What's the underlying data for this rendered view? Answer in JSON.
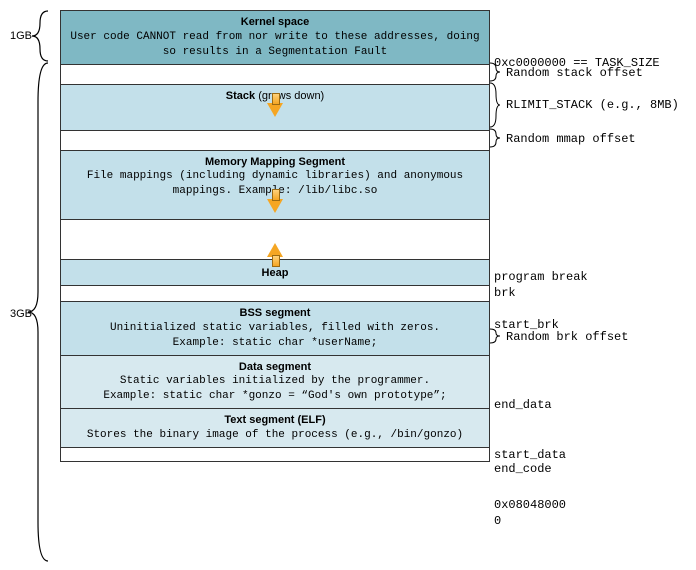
{
  "left": {
    "top_size": "1GB",
    "bottom_size": "3GB"
  },
  "kernel": {
    "title": "Kernel space",
    "desc": "User code CANNOT read from nor write to these addresses, doing so results in a Segmentation Fault"
  },
  "stack": {
    "title": "Stack",
    "suffix": " (grows down)"
  },
  "mmap": {
    "title": "Memory Mapping Segment",
    "desc": "File mappings (including dynamic libraries) and anonymous mappings. Example: /lib/libc.so"
  },
  "heap": {
    "title": "Heap"
  },
  "bss": {
    "title": "BSS segment",
    "desc1": "Uninitialized static variables, filled with zeros.",
    "desc2": "Example: static char *userName;"
  },
  "dataseg": {
    "title": "Data segment",
    "desc1": "Static variables initialized by the programmer.",
    "desc2": "Example: static char *gonzo = “God's own prototype”;"
  },
  "textseg": {
    "title": "Text segment (ELF)",
    "desc": "Stores the binary image of the process (e.g., /bin/gonzo)"
  },
  "right": {
    "task_size": "0xc0000000 == TASK_SIZE",
    "rand_stack": "Random stack offset",
    "rlimit": "RLIMIT_STACK (e.g., 8MB)",
    "rand_mmap": "Random mmap offset",
    "prog_break": "program break",
    "brk": "brk",
    "start_brk": "start_brk",
    "rand_brk": "Random brk offset",
    "end_data": "end_data",
    "start_data": "start_data",
    "end_code": "end_code",
    "text_addr": "0x08048000",
    "zero": "0"
  }
}
